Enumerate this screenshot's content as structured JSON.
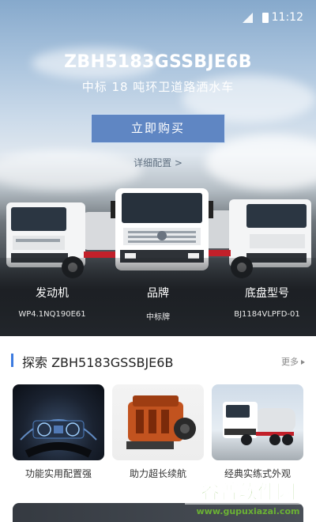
{
  "status_bar": {
    "time": "11:12"
  },
  "hero": {
    "model": "ZBH5183GSSBJE6B",
    "subtitle": "中标 18 吨环卫道路洒水车",
    "buy_label": "立即购买",
    "detail_label": "详细配置 >",
    "specs": [
      {
        "label": "发动机",
        "value": "WP4.1NQ190E61"
      },
      {
        "label": "品牌",
        "value": "中标牌"
      },
      {
        "label": "底盘型号",
        "value": "BJ1184VLPFD-01"
      }
    ]
  },
  "explore": {
    "title": "探索 ZBH5183GSSBJE6B",
    "more_label": "更多",
    "cards": [
      {
        "label": "功能实用配置强",
        "icon": "dashboard-image"
      },
      {
        "label": "助力超长续航",
        "icon": "engine-image"
      },
      {
        "label": "经典实练式外观",
        "icon": "truck-image"
      }
    ]
  },
  "watermark": {
    "brand": "谷普软件园",
    "url": "www.gupuxiazai.com"
  },
  "colors": {
    "accent": "#3d7be0",
    "button": "#5f86c3"
  }
}
